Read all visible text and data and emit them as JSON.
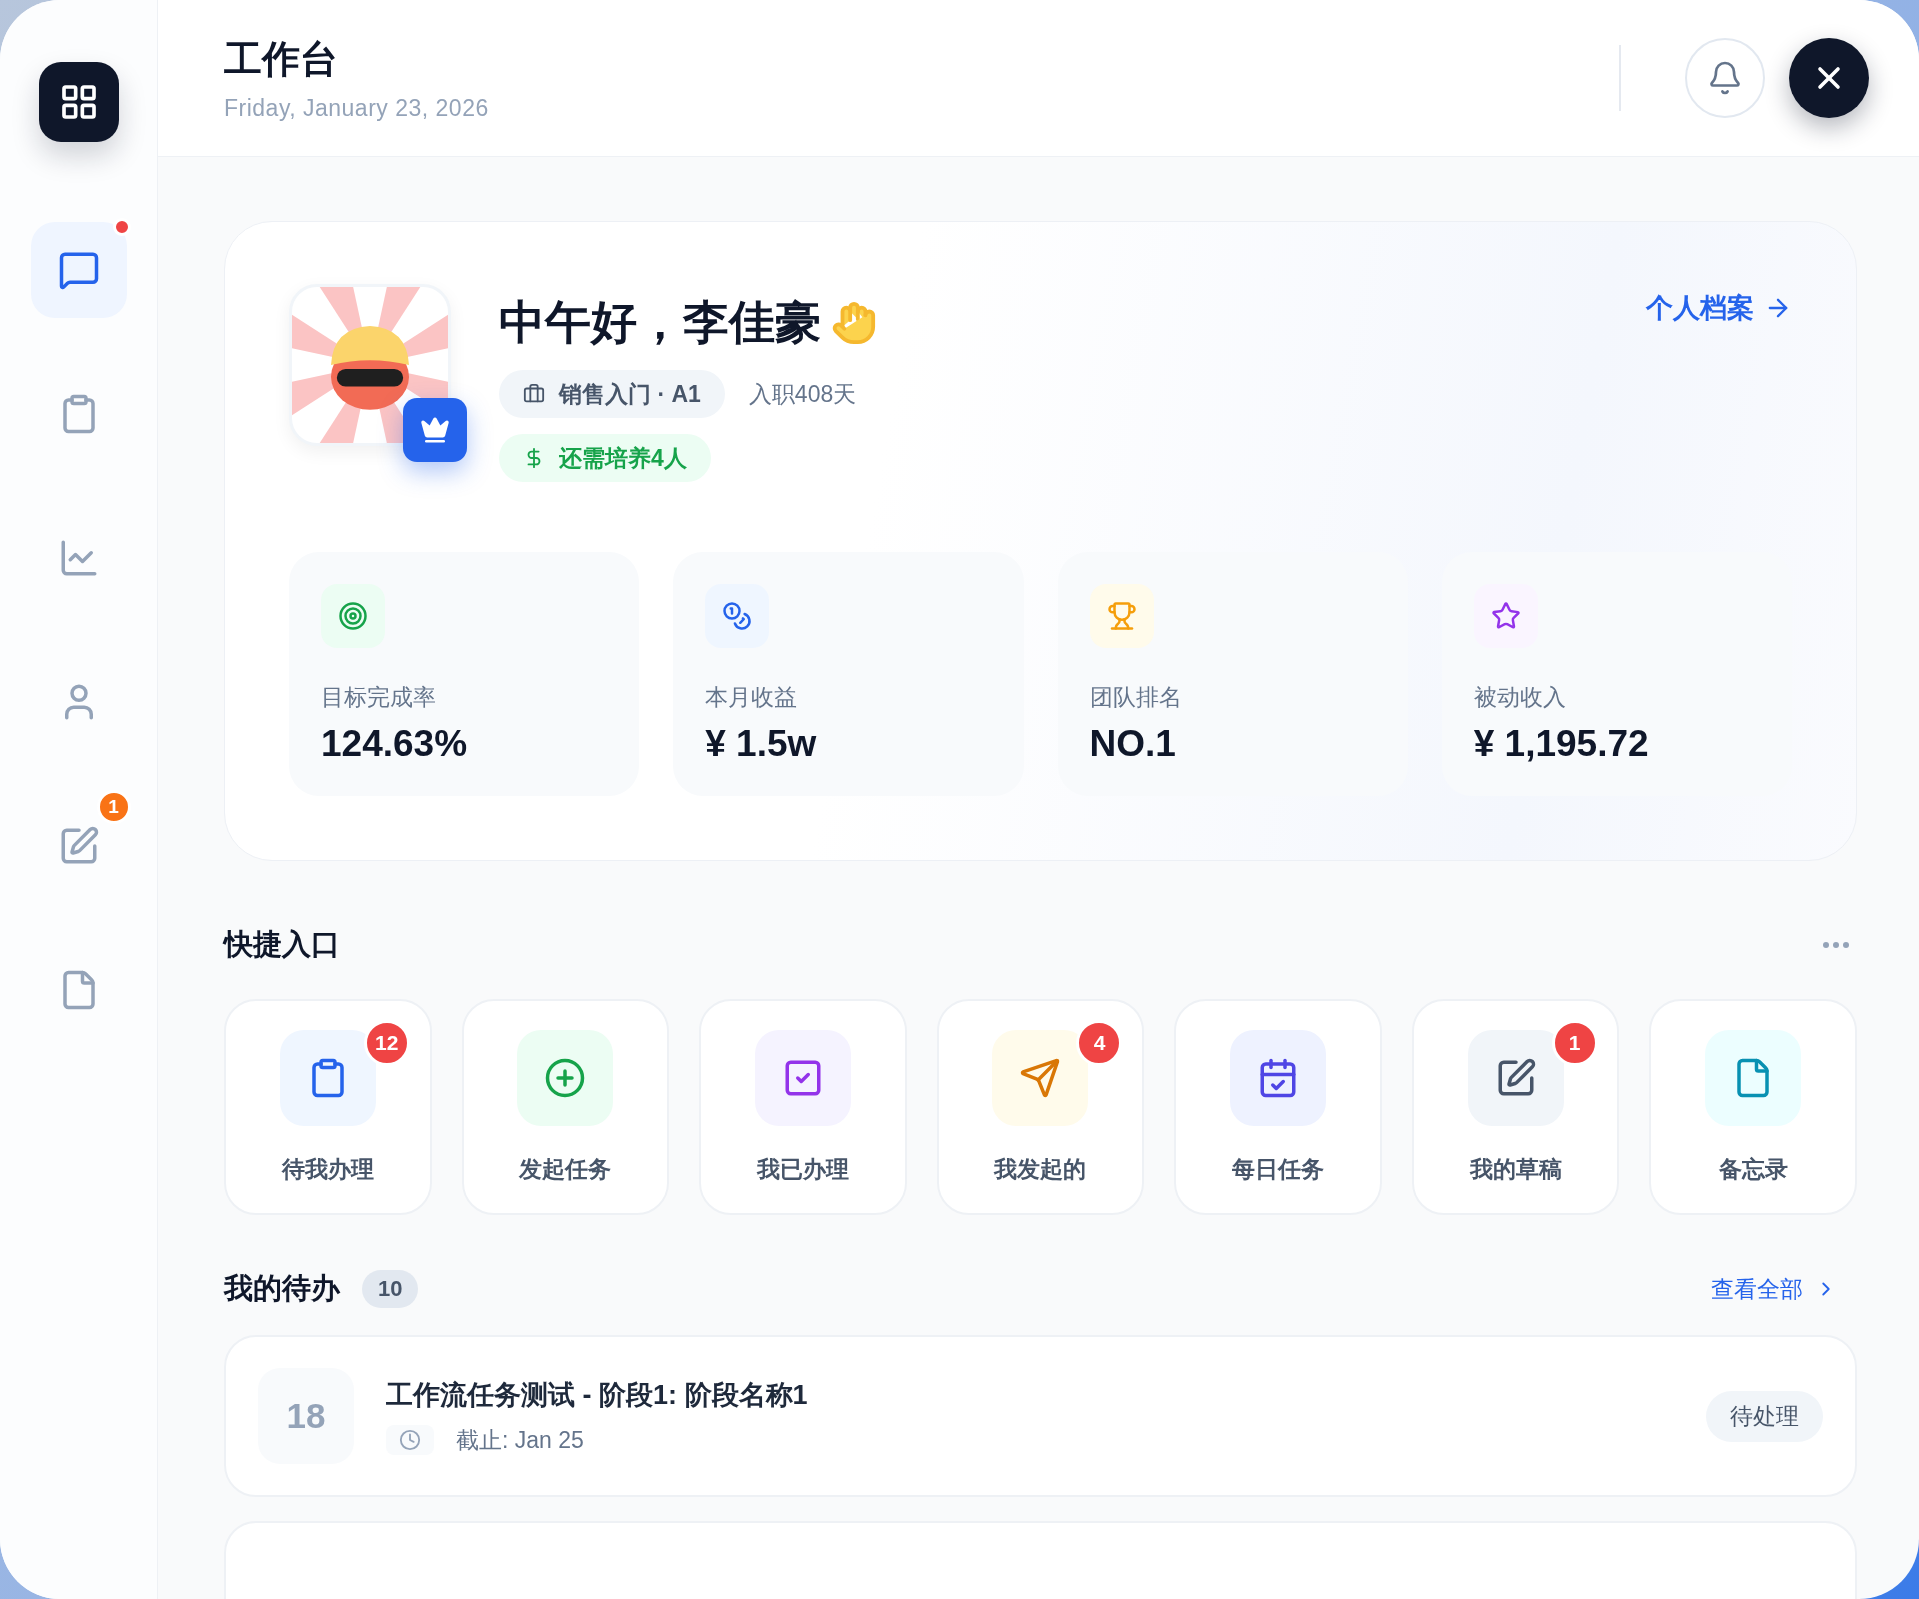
{
  "sidebar": {
    "items": [
      {
        "selected": true,
        "dot": true
      },
      {
        "selected": false,
        "dot": false
      },
      {
        "selected": false,
        "dot": false
      },
      {
        "selected": false,
        "dot": false
      },
      {
        "selected": false,
        "dot": false,
        "badge": "1"
      },
      {
        "selected": false,
        "dot": false
      }
    ]
  },
  "header": {
    "title": "工作台",
    "date": "Friday, January 23, 2026"
  },
  "profile": {
    "greeting": "中午好，李佳豪",
    "role_tag": "销售入门 · A1",
    "tenure": "入职408天",
    "goal_tag": "还需培养4人",
    "profile_link": "个人档案",
    "stats": [
      {
        "label": "目标完成率",
        "value": "124.63%"
      },
      {
        "label": "本月收益",
        "value": "¥ 1.5w"
      },
      {
        "label": "团队排名",
        "value": "NO.1"
      },
      {
        "label": "被动收入",
        "value": "¥ 1,195.72"
      }
    ]
  },
  "quick_access": {
    "title": "快捷入口",
    "items": [
      {
        "label": "待我办理",
        "badge": "12"
      },
      {
        "label": "发起任务"
      },
      {
        "label": "我已办理"
      },
      {
        "label": "我发起的",
        "badge": "4"
      },
      {
        "label": "每日任务"
      },
      {
        "label": "我的草稿",
        "badge": "1"
      },
      {
        "label": "备忘录"
      }
    ]
  },
  "todos": {
    "title": "我的待办",
    "count": "10",
    "view_all": "查看全部",
    "items": [
      {
        "day": "18",
        "title": "工作流任务测试 - 阶段1: 阶段名称1",
        "deadline": "截止: Jan 25",
        "status": "待处理"
      }
    ]
  }
}
